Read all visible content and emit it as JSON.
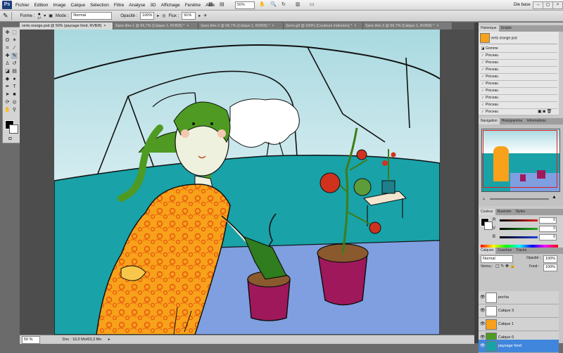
{
  "app": {
    "logo": "Ps"
  },
  "menu": {
    "items": [
      "Fichier",
      "Edition",
      "Image",
      "Calque",
      "Sélection",
      "Filtre",
      "Analyse",
      "3D",
      "Affichage",
      "Fenêtre",
      "Aide"
    ]
  },
  "menubar_tools": {
    "zoom": "50%",
    "workspace": "Die base"
  },
  "options": {
    "forme_label": "Forme :",
    "brush_size": "17",
    "mode_label": "Mode :",
    "mode_value": "Normal",
    "opacite_label": "Opacité :",
    "opacite_value": "100%",
    "flux_label": "Flux :",
    "flux_value": "91%"
  },
  "tabs": [
    {
      "label": "verts orange.psd @ 50% (paysage fond, RVB/8)",
      "close": "×"
    },
    {
      "label": "Sans titre-1 @ 66,7% (Calque 1, RVB/8) *",
      "close": "×"
    },
    {
      "label": "Sans titre-2 @ 66,7% (Calque 1, RVB/8) *",
      "close": "×"
    },
    {
      "label": "Serre.gif @ 100% (Couleurs indexées) *",
      "close": "×"
    },
    {
      "label": "Sans titre-3 @ 66,7% (Calque 1, RVB/8) *",
      "close": "×"
    }
  ],
  "status": {
    "zoom": "50 %",
    "doc": "Doc : 16,0 Mo/63,3 Mo"
  },
  "history": {
    "tabs": [
      "Historique",
      "Scripts"
    ],
    "snapshot": "verts orange.psd",
    "items": [
      "Gomme",
      "Pinceau",
      "Pinceau",
      "Pinceau",
      "Pinceau",
      "Pinceau",
      "Pinceau",
      "Pinceau",
      "Pinceau",
      "Pinceau"
    ]
  },
  "navigator": {
    "tabs": [
      "Navigation",
      "Histogramme",
      "Informations"
    ]
  },
  "color": {
    "tabs": [
      "Couleur",
      "Nuancier",
      "Styles"
    ],
    "channels": [
      {
        "label": "R",
        "value": "0",
        "track": "#e02020"
      },
      {
        "label": "V",
        "value": "0",
        "track": "#20b020"
      },
      {
        "label": "B",
        "value": "0",
        "track": "#2040e0"
      }
    ]
  },
  "layers": {
    "tabs": [
      "Calques",
      "Couches",
      "Tracés"
    ],
    "blend": "Normal",
    "opacite_label": "Opacité :",
    "opacite_value": "100%",
    "verrou_label": "Verrou :",
    "fond_label": "Fond :",
    "fond_value": "100%",
    "items": [
      {
        "name": "pocha",
        "selected": false
      },
      {
        "name": "Calque 3",
        "selected": false
      },
      {
        "name": "Calque 1",
        "selected": false
      },
      {
        "name": "Calque 0",
        "selected": false
      },
      {
        "name": "paysage fond",
        "selected": true
      }
    ]
  },
  "colors": {
    "accent": "#3f86dc",
    "dress": "#f7a21a",
    "hair": "#4e9a22",
    "floor": "#19a2a8",
    "pot": "#a0185c",
    "table": "#7f9fe0"
  }
}
